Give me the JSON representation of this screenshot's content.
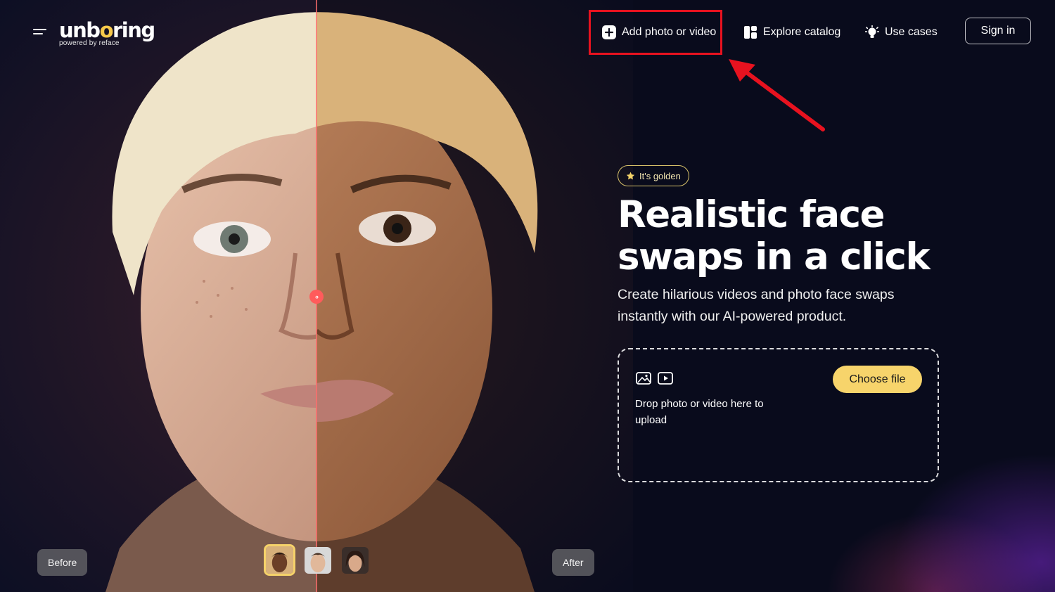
{
  "header": {
    "logo": {
      "wordmark": "unboring",
      "tagline": "powered by reface"
    },
    "nav": [
      {
        "label": "Add photo or video",
        "icon": "plus-square-icon"
      },
      {
        "label": "Explore catalog",
        "icon": "catalog-grid-icon"
      },
      {
        "label": "Use cases",
        "icon": "lightbulb-icon"
      }
    ],
    "sign_in_label": "Sign in"
  },
  "annotation": {
    "highlight_color": "#e8121f",
    "target": "Add photo or video"
  },
  "hero": {
    "badge": "It's golden",
    "title_line1": "Realistic face",
    "title_line2": "swaps in a click",
    "subtitle": "Create hilarious videos and photo face swaps instantly with our AI-powered product."
  },
  "upload": {
    "drop_text": "Drop photo or video here to upload",
    "choose_file_label": "Choose file",
    "icons": [
      "image-icon",
      "video-play-icon"
    ]
  },
  "comparison": {
    "before_label": "Before",
    "after_label": "After",
    "thumbnails": [
      "face-thumbnail-1",
      "face-thumbnail-2",
      "face-thumbnail-3"
    ],
    "selected_thumbnail": 1
  },
  "colors": {
    "background": "#090b1c",
    "accent_yellow": "#f7d46b",
    "divider": "#ff5b5b"
  }
}
